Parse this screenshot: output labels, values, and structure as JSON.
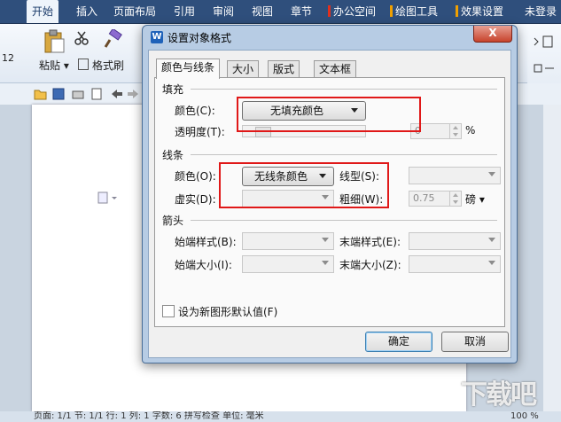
{
  "menubar": {
    "items": [
      "开始",
      "插入",
      "页面布局",
      "引用",
      "审阅",
      "视图",
      "章节",
      "办公空间",
      "绘图工具",
      "效果设置",
      "未登录"
    ],
    "accent_colors": [
      "#e0301e",
      "#f0a000",
      "#f0a000"
    ]
  },
  "ribbon": {
    "paste_label": "粘贴",
    "format_painter_label": "格式刷",
    "font_size_fragment": "12"
  },
  "dialog": {
    "title": "设置对象格式",
    "close_symbol": "X",
    "tabs": [
      "颜色与线条",
      "大小",
      "版式",
      "文本框"
    ],
    "active_tab": "颜色与线条",
    "fill": {
      "section": "填充",
      "color_label": "颜色(C):",
      "color_value": "无填充颜色",
      "transparency_label": "透明度(T):",
      "transparency_value": "0",
      "transparency_unit": "%"
    },
    "line": {
      "section": "线条",
      "color_label": "颜色(O):",
      "color_value": "无线条颜色",
      "style_label": "线型(S):",
      "dash_label": "虚实(D):",
      "weight_label": "粗细(W):",
      "weight_value": "0.75",
      "weight_unit": "磅"
    },
    "arrows": {
      "section": "箭头",
      "begin_style_label": "始端样式(B):",
      "end_style_label": "末端样式(E):",
      "begin_size_label": "始端大小(I):",
      "end_size_label": "末端大小(Z):"
    },
    "default_checkbox_label": "设为新图形默认值(F)",
    "ok_label": "确定",
    "cancel_label": "取消"
  },
  "statusbar": {
    "text": "页面: 1/1   节: 1/1   行: 1   列: 1   字数: 6   拼写检查   单位: 毫米",
    "zoom": "100 %"
  },
  "watermark": "下载吧",
  "colors": {
    "highlight": "#e01818",
    "titlebar": "#b7cce4",
    "menubar": "#2f4f7c"
  }
}
